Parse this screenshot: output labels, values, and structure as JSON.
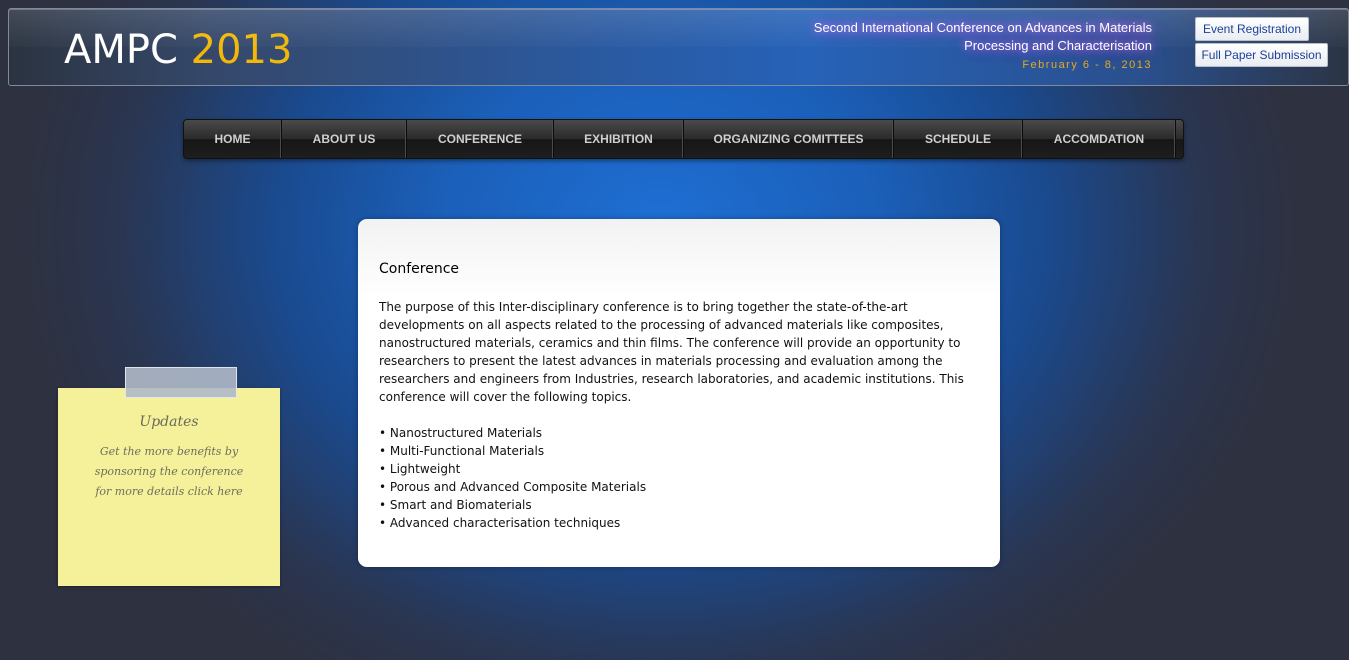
{
  "header": {
    "logo_text": "AMPC",
    "logo_year": "2013",
    "conference_title_line1": "Second International Conference on Advances in Materials",
    "conference_title_line2": "Processing and Characterisation",
    "conference_date": "February 6 - 8, 2013",
    "event_registration_label": "Event Registration",
    "full_paper_submission_label": "Full Paper Submission"
  },
  "nav": {
    "items": [
      {
        "label": "HOME"
      },
      {
        "label": "ABOUT US"
      },
      {
        "label": "CONFERENCE"
      },
      {
        "label": "EXHIBITION"
      },
      {
        "label": "ORGANIZING COMITTEES"
      },
      {
        "label": "SCHEDULE"
      },
      {
        "label": "ACCOMDATION"
      }
    ]
  },
  "main": {
    "heading": "Conference",
    "description": "The purpose of this Inter-disciplinary conference is to bring together the state-of-the-art developments on all aspects related to the processing of advanced materials like composites, nanostructured materials, ceramics and thin films. The conference will provide an opportunity to researchers to present the latest advances in materials processing and evaluation among the researchers and engineers from Industries, research laboratories, and academic institutions. This conference will cover the following topics.",
    "topics": [
      "• Nanostructured Materials",
      "• Multi-Functional Materials",
      "• Lightweight",
      "• Porous and Advanced Composite Materials",
      "• Smart and Biomaterials",
      "• Advanced characterisation techniques"
    ]
  },
  "updates_note": {
    "title": "Updates",
    "text": "Get the more benefits by sponsoring the conference for more details click here"
  },
  "colors": {
    "accent_year": "#f2b707",
    "date_color": "#e8a820",
    "note_background": "#f4f19a",
    "background_blue": "#1e6fd4"
  }
}
